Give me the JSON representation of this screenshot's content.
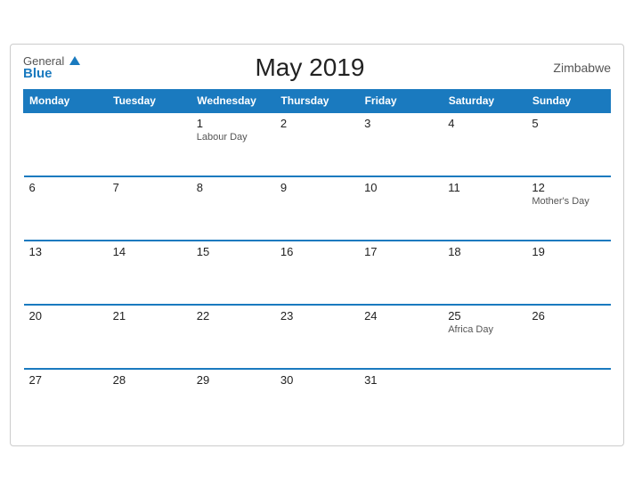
{
  "header": {
    "logo_general": "General",
    "logo_blue": "Blue",
    "title": "May 2019",
    "country": "Zimbabwe"
  },
  "days_of_week": [
    "Monday",
    "Tuesday",
    "Wednesday",
    "Thursday",
    "Friday",
    "Saturday",
    "Sunday"
  ],
  "weeks": [
    [
      {
        "day": "",
        "event": ""
      },
      {
        "day": "",
        "event": ""
      },
      {
        "day": "1",
        "event": "Labour Day"
      },
      {
        "day": "2",
        "event": ""
      },
      {
        "day": "3",
        "event": ""
      },
      {
        "day": "4",
        "event": ""
      },
      {
        "day": "5",
        "event": ""
      }
    ],
    [
      {
        "day": "6",
        "event": ""
      },
      {
        "day": "7",
        "event": ""
      },
      {
        "day": "8",
        "event": ""
      },
      {
        "day": "9",
        "event": ""
      },
      {
        "day": "10",
        "event": ""
      },
      {
        "day": "11",
        "event": ""
      },
      {
        "day": "12",
        "event": "Mother's Day"
      }
    ],
    [
      {
        "day": "13",
        "event": ""
      },
      {
        "day": "14",
        "event": ""
      },
      {
        "day": "15",
        "event": ""
      },
      {
        "day": "16",
        "event": ""
      },
      {
        "day": "17",
        "event": ""
      },
      {
        "day": "18",
        "event": ""
      },
      {
        "day": "19",
        "event": ""
      }
    ],
    [
      {
        "day": "20",
        "event": ""
      },
      {
        "day": "21",
        "event": ""
      },
      {
        "day": "22",
        "event": ""
      },
      {
        "day": "23",
        "event": ""
      },
      {
        "day": "24",
        "event": ""
      },
      {
        "day": "25",
        "event": "Africa Day"
      },
      {
        "day": "26",
        "event": ""
      }
    ],
    [
      {
        "day": "27",
        "event": ""
      },
      {
        "day": "28",
        "event": ""
      },
      {
        "day": "29",
        "event": ""
      },
      {
        "day": "30",
        "event": ""
      },
      {
        "day": "31",
        "event": ""
      },
      {
        "day": "",
        "event": ""
      },
      {
        "day": "",
        "event": ""
      }
    ]
  ]
}
